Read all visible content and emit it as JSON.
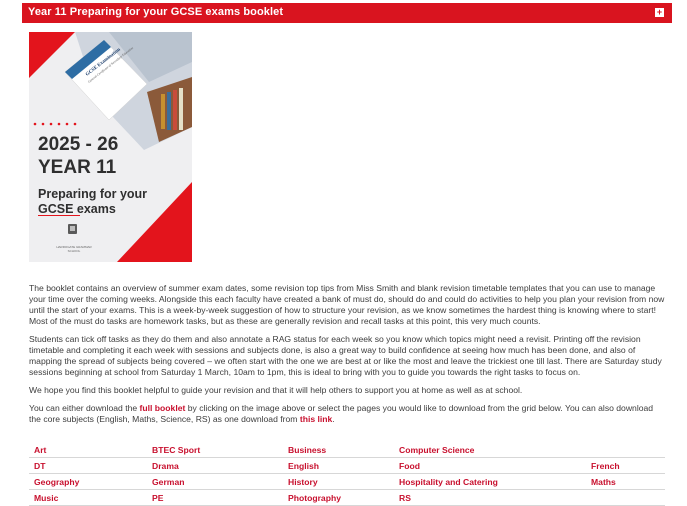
{
  "header": {
    "title": "Year 11 Preparing for your GCSE exams booklet",
    "expand_symbol": "+"
  },
  "cover": {
    "book_title": "GCSE Examination",
    "book_subtitle": "General Certificate of Secondary Education",
    "year_range": "2025 - 26",
    "year_group": "YEAR 11",
    "subtitle": "Preparing for your GCSE exams",
    "school_name": "HARROGATE GRAMMAR SCHOOL",
    "accent_color": "#e3141c"
  },
  "content": {
    "para1": "The booklet contains an overview of summer exam dates, some revision top tips from Miss Smith and blank revision timetable templates that you can use to manage your time over the coming weeks.  Alongside this each faculty have created a bank of must do, should do and could do activities to help you plan your revision from now until the start of your exams.  This is a week-by-week suggestion of how to structure your revision, as we know sometimes the hardest thing is knowing where to start! Most of the must do tasks are homework tasks, but as these are generally revision and recall tasks at this point, this very much counts.",
    "para2": "Students can tick off tasks as they do them and also annotate a RAG status for each week so you know which topics might need a revisit. Printing off the revision timetable and completing it each week with sessions and subjects done, is also a great way to build confidence at seeing how much has been done, and also of mapping the spread of subjects being covered – we often start with the one we are best at or like the most and leave the trickiest one till last. There are Saturday study sessions beginning at school from Saturday 1 March, 10am to 1pm, this is ideal to bring with you to guide you towards the right tasks to focus on.",
    "para3": "We hope you find this booklet helpful to guide your revision and that it will help others to support you at home as well as at school.",
    "para4_a": "You can either download the ",
    "full_booklet_link": "full booklet",
    "para4_b": " by clicking on the image above or select the pages you would like to download from the grid below.  You can also download the core subjects (English, Maths, Science, RS) as one download from ",
    "this_link": "this link",
    "para4_c": "."
  },
  "subjects": {
    "rows": [
      [
        "Art",
        "BTEC Sport",
        "Business",
        "Computer Science",
        ""
      ],
      [
        "DT",
        "Drama",
        "English",
        "Food",
        "French"
      ],
      [
        "Geography",
        "German",
        "History",
        "Hospitality and Catering",
        "Maths"
      ],
      [
        "Music",
        "PE",
        "Photography",
        "RS",
        ""
      ]
    ]
  }
}
